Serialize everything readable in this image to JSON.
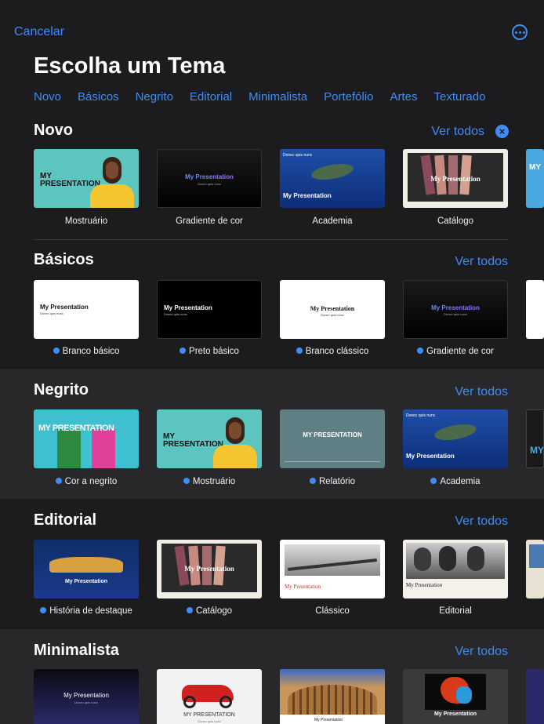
{
  "header": {
    "cancel_label": "Cancelar",
    "more_icon": "ellipsis-circle-icon",
    "title": "Escolha um Tema"
  },
  "filters": [
    "Novo",
    "Básicos",
    "Negrito",
    "Editorial",
    "Minimalista",
    "Portefólio",
    "Artes",
    "Texturado"
  ],
  "sections": [
    {
      "title": "Novo",
      "link": "Ver todos",
      "themes": [
        {
          "name": "Mostruário",
          "dot": false
        },
        {
          "name": "Gradiente de cor",
          "dot": false
        },
        {
          "name": "Academia",
          "dot": false
        },
        {
          "name": "Catálogo",
          "dot": false
        }
      ]
    },
    {
      "title": "Básicos",
      "link": "Ver todos",
      "themes": [
        {
          "name": "Branco básico",
          "dot": true
        },
        {
          "name": "Preto básico",
          "dot": true
        },
        {
          "name": "Branco clássico",
          "dot": true
        },
        {
          "name": "Gradiente de cor",
          "dot": true
        }
      ]
    },
    {
      "title": "Negrito",
      "link": "Ver todos",
      "themes": [
        {
          "name": "Cor a negrito",
          "dot": true
        },
        {
          "name": "Mostruário",
          "dot": true
        },
        {
          "name": "Relatório",
          "dot": true
        },
        {
          "name": "Academia",
          "dot": true
        }
      ]
    },
    {
      "title": "Editorial",
      "link": "Ver todos",
      "themes": [
        {
          "name": "História de destaque",
          "dot": true
        },
        {
          "name": "Catálogo",
          "dot": true
        },
        {
          "name": "Clássico",
          "dot": false
        },
        {
          "name": "Editorial",
          "dot": false
        }
      ]
    },
    {
      "title": "Minimalista",
      "link": "Ver todos",
      "themes": []
    }
  ],
  "slide_text": {
    "my_presentation_caps": "MY PRESENTATION",
    "my_presentation": "My Presentation",
    "subtitle": "Donec quis nunc",
    "my_caps_split_1": "MY",
    "my_caps_split_2": "PRESENTATION"
  },
  "colors": {
    "accent": "#3f8cf6",
    "background": "#1c1c1e",
    "band": "#28282a"
  }
}
